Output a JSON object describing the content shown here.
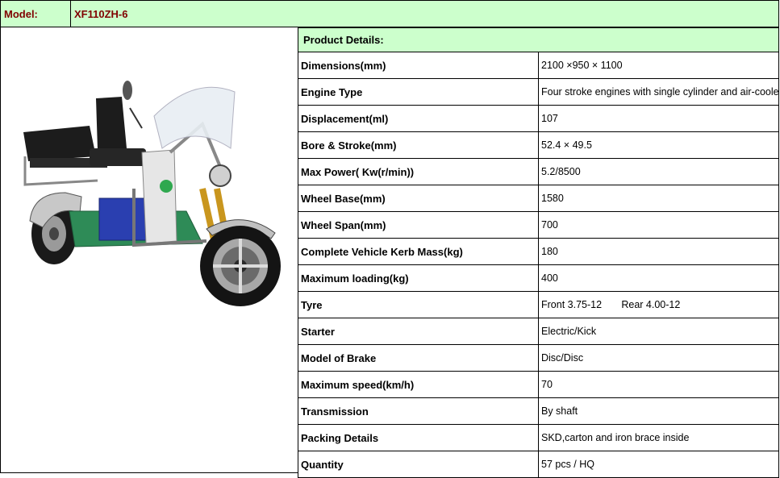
{
  "header": {
    "model_label": "Model:",
    "model_value": "XF110ZH-6"
  },
  "details_title": "Product Details:",
  "rows": [
    {
      "key": "Dimensions(mm)",
      "value": "2100 ×950 × 1100"
    },
    {
      "key": "Engine Type",
      "value": "Four stroke engines with single cylinder and air-cooled"
    },
    {
      "key": "Displacement(ml)",
      "value": "107"
    },
    {
      "key": "Bore & Stroke(mm)",
      "value": "52.4 × 49.5"
    },
    {
      "key": "Max Power( Kw(r/min))",
      "value": "5.2/8500"
    },
    {
      "key": "Wheel Base(mm)",
      "value": "1580"
    },
    {
      "key": "Wheel Span(mm)",
      "value": "700"
    },
    {
      "key": "Complete Vehicle Kerb Mass(kg)",
      "value": "180"
    },
    {
      "key": "Maximum loading(kg)",
      "value": "400"
    },
    {
      "key": "Tyre",
      "value": "Front 3.75-12       Rear 4.00-12"
    },
    {
      "key": "Starter",
      "value": "Electric/Kick"
    },
    {
      "key": "Model of Brake",
      "value": "Disc/Disc"
    },
    {
      "key": "Maximum speed(km/h)",
      "value": "70"
    },
    {
      "key": "Transmission",
      "value": "By shaft"
    },
    {
      "key": "Packing Details",
      "value": "SKD,carton and iron brace inside"
    },
    {
      "key": "Quantity",
      "value": "57 pcs / HQ"
    }
  ]
}
